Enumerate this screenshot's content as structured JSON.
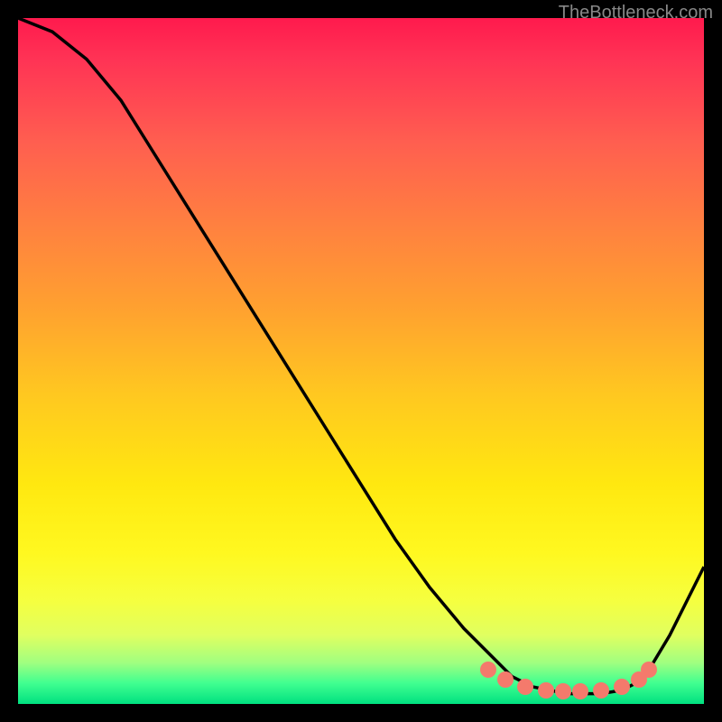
{
  "watermark": "TheBottleneck.com",
  "chart_data": {
    "type": "line",
    "title": "",
    "xlabel": "",
    "ylabel": "",
    "xlim": [
      0,
      100
    ],
    "ylim": [
      0,
      100
    ],
    "grid": false,
    "series": [
      {
        "name": "curve",
        "x": [
          0,
          5,
          10,
          15,
          20,
          25,
          30,
          35,
          40,
          45,
          50,
          55,
          60,
          65,
          70,
          72,
          75,
          80,
          85,
          88,
          90,
          92,
          95,
          100
        ],
        "y": [
          100,
          98,
          94,
          88,
          80,
          72,
          64,
          56,
          48,
          40,
          32,
          24,
          17,
          11,
          6,
          4,
          2.5,
          1.5,
          1.5,
          2,
          3,
          5,
          10,
          20
        ]
      }
    ],
    "markers": {
      "name": "dots",
      "x": [
        68.5,
        71,
        74,
        77,
        79.5,
        82,
        85,
        88,
        90.5,
        92
      ],
      "y": [
        5,
        3.5,
        2.5,
        2,
        1.8,
        1.8,
        2,
        2.5,
        3.5,
        5
      ]
    },
    "gradient_bands": {
      "description": "vertical gradient from red (top) through orange/yellow to green (bottom) representing bottleneck severity",
      "stops": [
        "#ff1a4d",
        "#ff8040",
        "#ffe810",
        "#40ff90",
        "#00e080"
      ]
    }
  }
}
